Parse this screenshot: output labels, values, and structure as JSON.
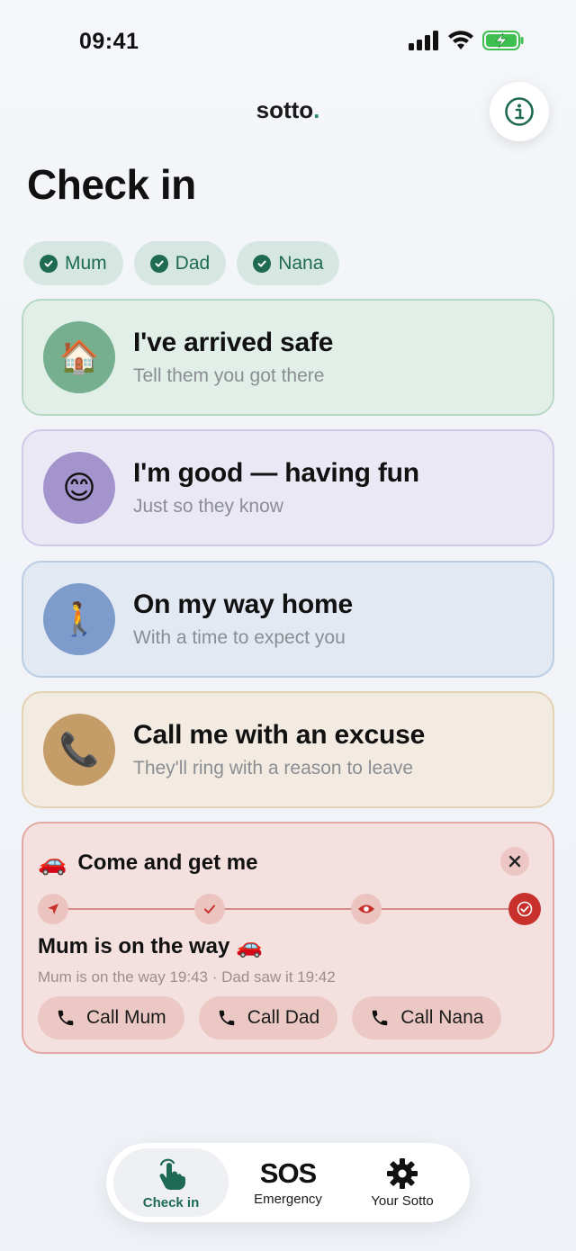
{
  "status_bar": {
    "time": "09:41"
  },
  "header": {
    "app_name": "sotto",
    "app_name_dot": "."
  },
  "page": {
    "title": "Check in"
  },
  "contacts": [
    {
      "name": "Mum"
    },
    {
      "name": "Dad"
    },
    {
      "name": "Nana"
    }
  ],
  "actions": [
    {
      "title": "I've arrived safe",
      "subtitle": "Tell them you got there",
      "icon": "🏠"
    },
    {
      "title": "I'm good — having fun",
      "subtitle": "Just so they know",
      "icon": "😊"
    },
    {
      "title": "On my way home",
      "subtitle": "With a time to expect you",
      "icon": "🚶"
    },
    {
      "title": "Call me with an excuse",
      "subtitle": "They'll ring with a reason to leave",
      "icon": "📞"
    }
  ],
  "come_get_me": {
    "icon": "🚗",
    "title": "Come and get me",
    "status": "Mum is on the way 🚗",
    "meta": "Mum is on the way 19:43 · Dad saw it 19:42",
    "calls": [
      {
        "label": "Call Mum"
      },
      {
        "label": "Call Dad"
      },
      {
        "label": "Call Nana"
      }
    ]
  },
  "nav": {
    "check_in": "Check in",
    "sos_glyph": "SOS",
    "emergency": "Emergency",
    "your_sotto": "Your Sotto"
  },
  "colors": {
    "accent_green": "#1f6a52",
    "alert_red": "#c8312b"
  }
}
